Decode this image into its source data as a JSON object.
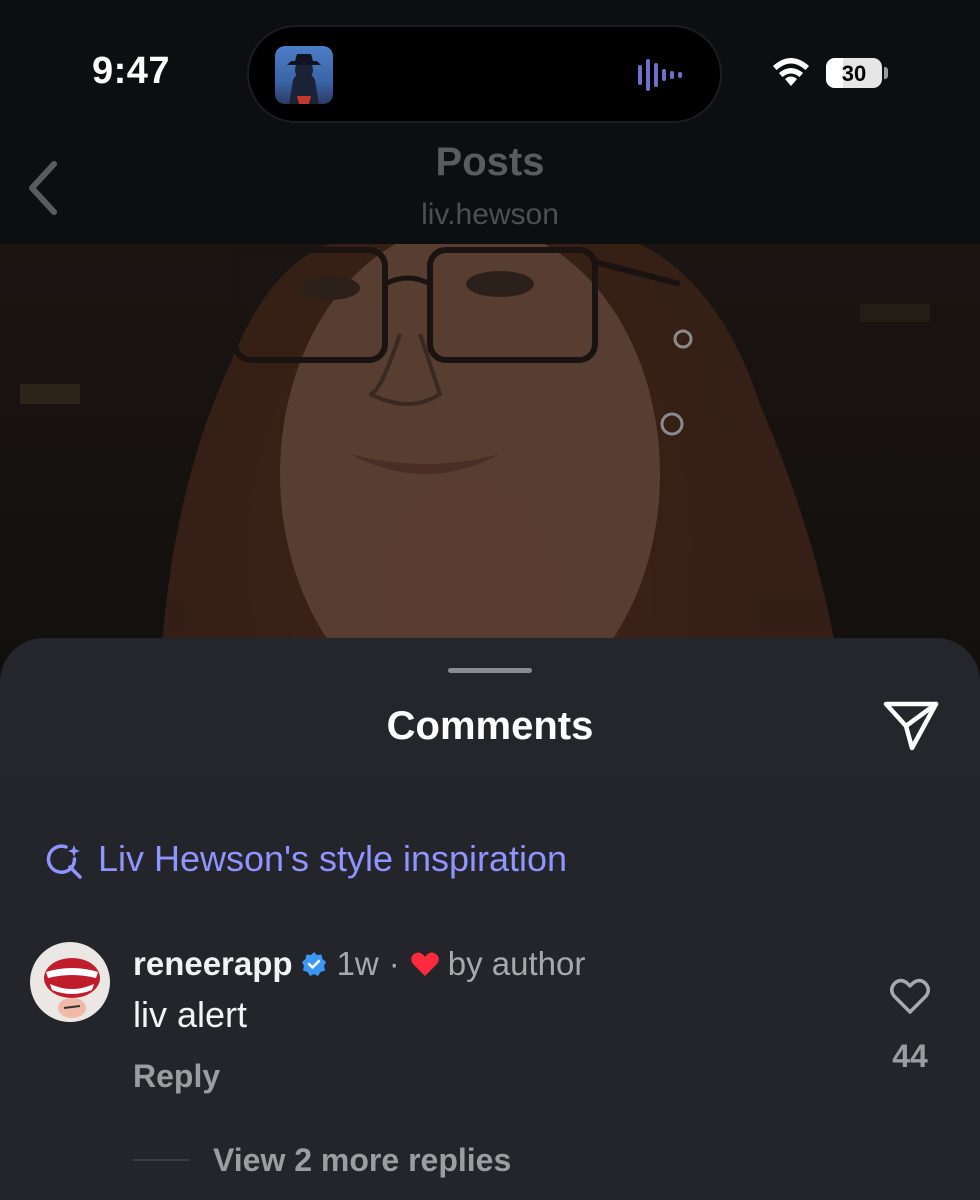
{
  "status_bar": {
    "time": "9:47",
    "battery": "30",
    "battery_level": 0.3
  },
  "header": {
    "title": "Posts",
    "username": "liv.hewson"
  },
  "comments_sheet": {
    "title": "Comments",
    "ai_suggestion": "Liv Hewson's style inspiration",
    "comment": {
      "username": "reneerapp",
      "time": "1w",
      "separator": "·",
      "liked_by": "by author",
      "text": "liv alert",
      "reply_label": "Reply",
      "like_count": "44"
    },
    "view_replies": "View 2 more replies"
  },
  "colors": {
    "accent_link": "#8f94ff",
    "verified": "#3b96f5",
    "heart": "#ff2a3d",
    "sheet_bg": "#23252a"
  }
}
